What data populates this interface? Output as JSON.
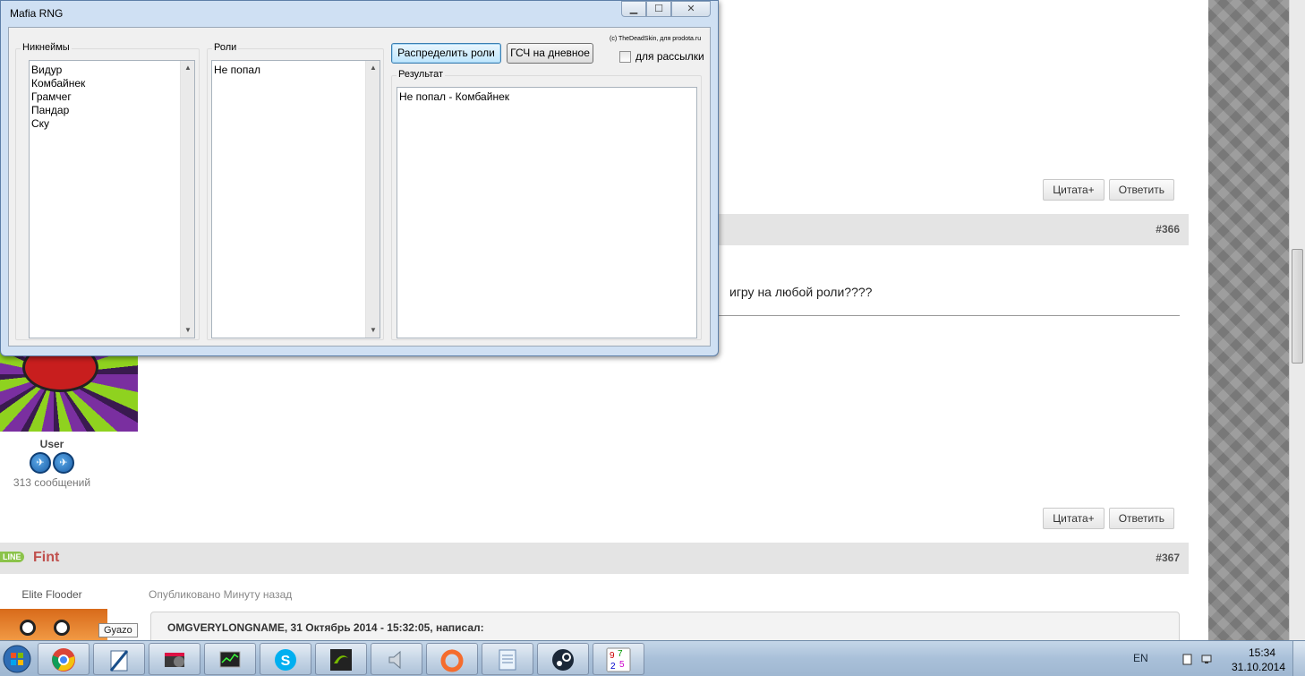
{
  "window": {
    "title": "Mafia RNG",
    "minimize_glyph": "▁",
    "maximize_glyph": "☐",
    "close_glyph": "✕",
    "nicknames_label": "Никнеймы",
    "nicknames": [
      "Видур",
      "Комбайнек",
      "Грамчег",
      "Пандар",
      "Ску"
    ],
    "roles_label": "Роли",
    "roles": [
      "Не попал"
    ],
    "distribute_button": "Распределить роли",
    "rng_day_button": "ГСЧ на дневное",
    "credit": "(c) TheDeadSkin, для prodota.ru",
    "mailing_checkbox_label": "для рассылки",
    "mailing_checked": false,
    "result_label": "Результат",
    "result_lines": [
      "Не попал - Комбайнек"
    ]
  },
  "forum": {
    "quote_button": "Цитата+",
    "reply_button": "Ответить",
    "post_366_number": "#366",
    "post_366_text": "игру на любой роли????",
    "user_name": "User",
    "user_post_count": "313 сообщений",
    "post_367_number": "#367",
    "online_badge": "LINE",
    "author_367": "Fint",
    "author_367_title": "Elite Flooder",
    "published": "Опубликовано Минуту назад",
    "quote_header": "OMGVERYLONGNAME, 31 Октябрь 2014 - 15:32:05, написал:",
    "tooltip": "Gyazo"
  },
  "taskbar": {
    "apps": [
      "chrome-icon",
      "notepad-icon",
      "media-player-icon",
      "task-manager-icon",
      "skype-icon",
      "nvidia-icon",
      "volume-mixer-icon",
      "origin-icon",
      "notepad2-icon",
      "steam-icon",
      "rng-app-icon"
    ],
    "language": "EN",
    "time": "15:34",
    "date": "31.10.2014"
  },
  "colors": {
    "accent_link": "#6ea7d8",
    "author_red": "#c0504d",
    "online_green": "#8bc34a"
  }
}
